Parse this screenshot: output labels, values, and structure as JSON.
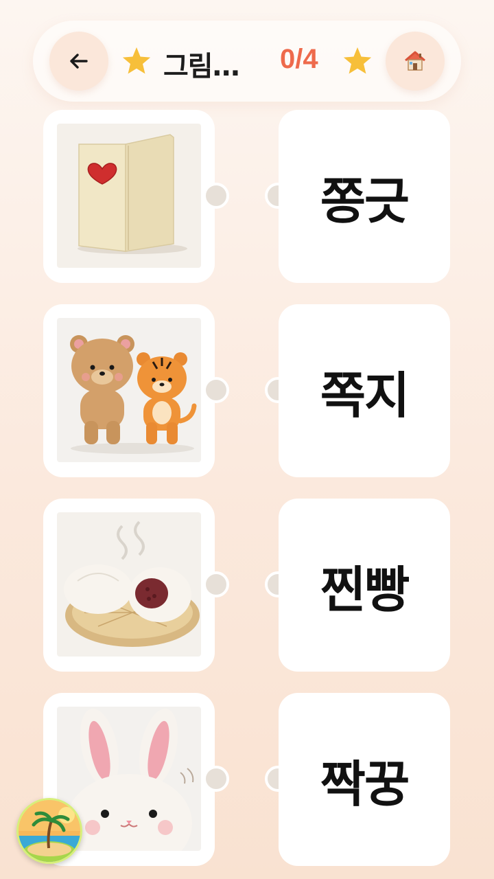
{
  "header": {
    "back_icon": "arrow-left-icon",
    "title": "그림…",
    "progress": "0/4",
    "home_icon": "house-icon",
    "star_color": "#f7bf3a",
    "progress_color": "#ee6a4c"
  },
  "rows": [
    {
      "image": "felt-wallet-with-heart",
      "word": "쫑긋"
    },
    {
      "image": "felt-bear-and-tiger",
      "word": "쪽지"
    },
    {
      "image": "felt-steamed-buns",
      "word": "찐빵"
    },
    {
      "image": "felt-bunny",
      "word": "짝꿍"
    }
  ],
  "floating": {
    "icon": "beach-island-icon"
  }
}
